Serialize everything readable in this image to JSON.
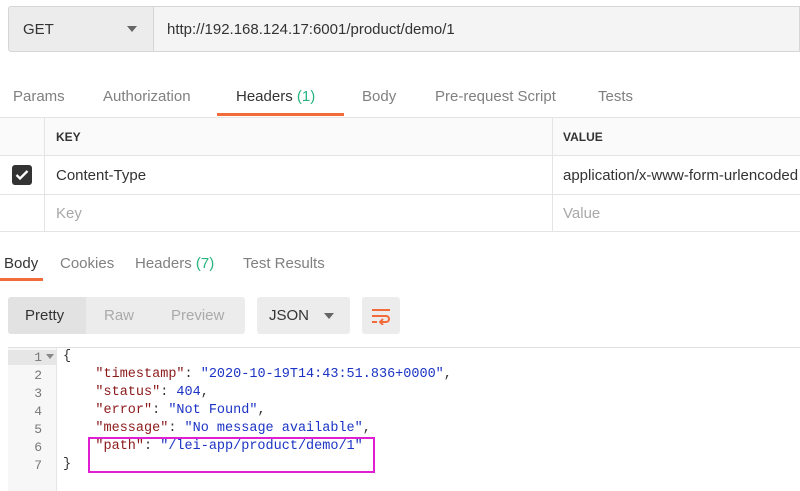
{
  "request": {
    "method": "GET",
    "url": "http://192.168.124.17:6001/product/demo/1"
  },
  "request_tabs": [
    {
      "label": "Params"
    },
    {
      "label": "Authorization"
    },
    {
      "label": "Headers",
      "count": "(1)",
      "active": true
    },
    {
      "label": "Body"
    },
    {
      "label": "Pre-request Script"
    },
    {
      "label": "Tests"
    }
  ],
  "headers_table": {
    "key_header": "KEY",
    "value_header": "VALUE",
    "rows": [
      {
        "checked": true,
        "key": "Content-Type",
        "value": "application/x-www-form-urlencoded"
      }
    ],
    "key_placeholder": "Key",
    "value_placeholder": "Value"
  },
  "response_tabs": [
    {
      "label": "Body",
      "active": true
    },
    {
      "label": "Cookies"
    },
    {
      "label": "Headers",
      "count": "(7)"
    },
    {
      "label": "Test Results"
    }
  ],
  "format": {
    "modes": [
      "Pretty",
      "Raw",
      "Preview"
    ],
    "active_mode": "Pretty",
    "language": "JSON",
    "wrap_icon": "wrap-lines-icon"
  },
  "editor": {
    "line_numbers": [
      "1",
      "2",
      "3",
      "4",
      "5",
      "6",
      "7"
    ],
    "lines": {
      "open": "{",
      "timestamp_key": "\"timestamp\"",
      "timestamp_val": "\"2020-10-19T14:43:51.836+0000\"",
      "status_key": "\"status\"",
      "status_val": "404",
      "error_key": "\"error\"",
      "error_val": "\"Not Found\"",
      "message_key": "\"message\"",
      "message_val": "\"No message available\"",
      "path_key": "\"path\"",
      "path_val": "\"/lei-app/product/demo/1\"",
      "close": "}"
    }
  },
  "colors": {
    "accent": "#f26b3a",
    "count": "#26b47f",
    "highlight": "#e01ed4"
  }
}
